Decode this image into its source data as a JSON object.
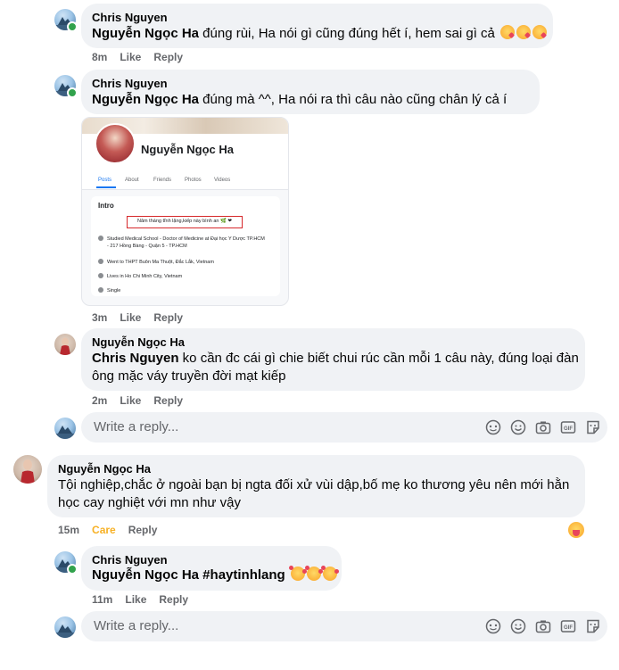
{
  "comments": [
    {
      "author": "Chris Nguyen",
      "mention": "Nguyễn Ngọc Ha",
      "text": " đúng rùi, Ha nói gì cũng đúng hết í, hem sai gì cả",
      "emojis": [
        "kissing-heart-emoji",
        "kissing-heart-emoji",
        "kissing-heart-emoji"
      ],
      "time": "8m",
      "like": "Like",
      "reply": "Reply"
    },
    {
      "author": "Chris Nguyen",
      "mention": "Nguyễn Ngọc Ha",
      "text": " đúng mà ^^, Ha nói ra thì câu nào cũng chân lý cả í",
      "time": "3m",
      "like": "Like",
      "reply": "Reply",
      "attachment": {
        "profile_name": "Nguyễn Ngọc Ha",
        "tabs": [
          "Posts",
          "About",
          "Friends",
          "Photos",
          "Videos"
        ],
        "intro_title": "Intro",
        "bio": "Năm tháng tĩnh lặng,kiếp này bình an 🌿 ❤",
        "details": [
          "Studied Medical School - Doctor of Medicine at Đại học Y Dược TP.HCM - 217 Hồng Bàng - Quận 5 - TP.HCM",
          "Went to THPT Buôn Ma Thuột, Đắc Lắk, Vietnam",
          "Lives in Ho Chi Minh City, Vietnam",
          "Single"
        ]
      }
    },
    {
      "author": "Nguyễn Ngọc Ha",
      "mention": "Chris Nguyen",
      "text_line1": " ko cần đc cái gì chie biết chui rúc cần mỗi 1 câu này, đúng loại đàn",
      "text_line2": "ông mặc váy truyền đời mạt kiếp",
      "time": "2m",
      "like": "Like",
      "reply": "Reply"
    },
    {
      "author": "Nguyễn Ngọc Ha",
      "text_line1": "Tội nghiệp,chắc ở ngoài bạn bị ngta đối xử vùi dập,bố mẹ ko thương yêu nên mới hằn",
      "text_line2": "học cay nghiệt với mn như vậy",
      "time": "15m",
      "reaction_label": "Care",
      "reply": "Reply",
      "reaction_icon": "care-reaction-icon"
    },
    {
      "author": "Chris Nguyen",
      "mention": "Nguyễn Ngọc Ha",
      "text": " #haytinhlang",
      "emojis": [
        "smiling-face-with-hearts-emoji",
        "smiling-face-with-hearts-emoji",
        "smiling-face-with-hearts-emoji"
      ],
      "time": "11m",
      "like": "Like",
      "reply": "Reply"
    }
  ],
  "reply_box": {
    "placeholder": "Write a reply...",
    "tools": [
      "avatar-sticker-icon",
      "emoji-icon",
      "camera-icon",
      "gif-icon",
      "sticker-icon"
    ]
  },
  "colors": {
    "bubble": "#f0f2f5",
    "meta": "#65676b",
    "care": "#f7b125",
    "online": "#31a24c"
  }
}
